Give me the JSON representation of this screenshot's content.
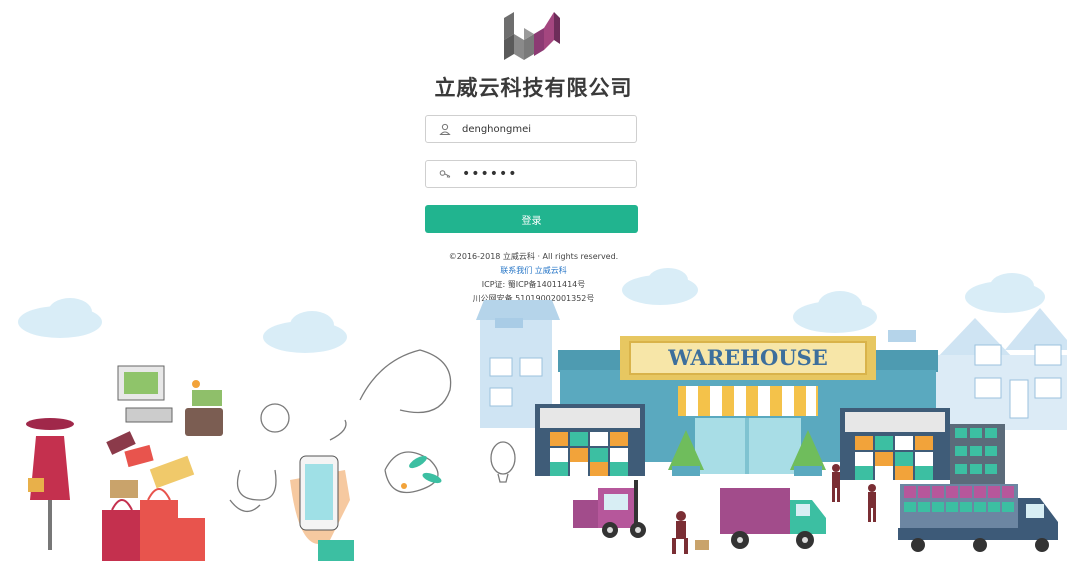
{
  "brand": {
    "company_name": "立威云科技有限公司",
    "logo_icon": "lw-logo-icon"
  },
  "login": {
    "username_value": "denghongmei",
    "password_value": "••••••",
    "submit_label": "登录",
    "user_icon": "user-icon",
    "key_icon": "key-icon"
  },
  "footer": {
    "copyright": "©2016-2018 立威云科 · All rights reserved.",
    "contact_link": "联系我们 立威云科",
    "icp": "ICP证: 蜀ICP备14011414号",
    "police": "川公网安备 51019002001352号"
  },
  "illustration": {
    "sign_text": "WAREHOUSE"
  },
  "colors": {
    "accent": "#21b48f",
    "link": "#2a78c8",
    "logo_gray": "#6e6e6e",
    "logo_purple": "#8c3a73"
  }
}
